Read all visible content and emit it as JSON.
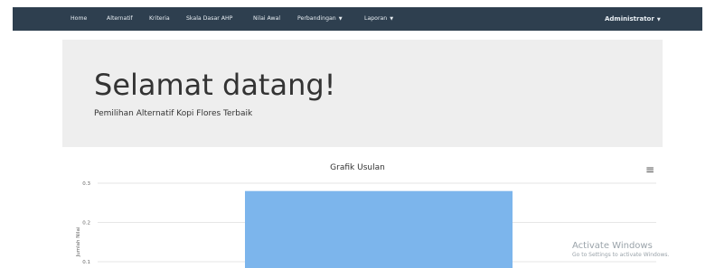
{
  "nav": {
    "items": [
      {
        "label": "Home",
        "dropdown": false
      },
      {
        "label": "Alternatif",
        "dropdown": false
      },
      {
        "label": "Kriteria",
        "dropdown": false
      },
      {
        "label": "Skala Dasar AHP",
        "dropdown": false
      },
      {
        "label": "Nilai Awal",
        "dropdown": false
      },
      {
        "label": "Perbandingan",
        "dropdown": true
      },
      {
        "label": "Laporan",
        "dropdown": true
      }
    ],
    "user_label": "Administrator",
    "bg_color": "#2e3f4f"
  },
  "hero": {
    "title": "Selamat datang!",
    "subtitle": "Pemilihan Alternatif Kopi Flores Terbaik"
  },
  "chart_menu_icon": "hamburger-menu-icon",
  "chart_data": {
    "type": "bar",
    "title": "Grafik Usulan",
    "ylabel": "Jumlah Nilai",
    "xlabel": "",
    "categories": [
      ""
    ],
    "series": [
      {
        "values": [
          0.28
        ]
      }
    ],
    "y_ticks": [
      "0.3",
      "0.2",
      "0.1"
    ],
    "ylim": [
      0,
      0.3
    ],
    "bar_color": "#7cb5ec",
    "grid": true
  },
  "watermark": {
    "line1": "Activate Windows",
    "line2": "Go to Settings to activate Windows."
  }
}
